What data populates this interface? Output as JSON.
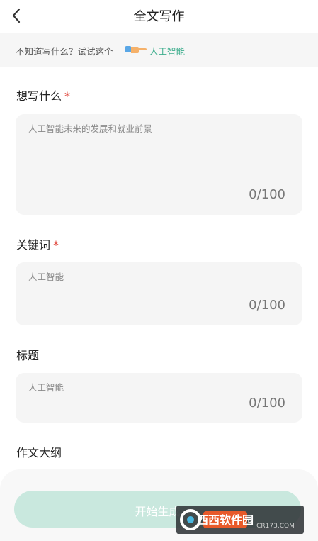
{
  "header": {
    "title": "全文写作",
    "back_icon": "back-arrow-icon"
  },
  "tip": {
    "text": "不知道写什么？试试这个",
    "link": "人工智能",
    "hand_icon": "pointing-hand-icon"
  },
  "fields": {
    "topic": {
      "label": "想写什么",
      "required_mark": "*",
      "placeholder": "人工智能未来的发展和就业前景",
      "counter": "0/100"
    },
    "keywords": {
      "label": "关键词",
      "required_mark": "*",
      "placeholder": "人工智能",
      "counter": "0/100"
    },
    "title": {
      "label": "标题",
      "placeholder": "人工智能",
      "counter": "0/100"
    },
    "outline": {
      "label": "作文大纲"
    }
  },
  "generate_button": {
    "label": "开始生成"
  },
  "watermark": {
    "brand": "西西软件园",
    "domain": "CR173.COM"
  },
  "colors": {
    "accent": "#3fae8e",
    "required": "#e0473c",
    "button_disabled": "#c9e8de"
  }
}
